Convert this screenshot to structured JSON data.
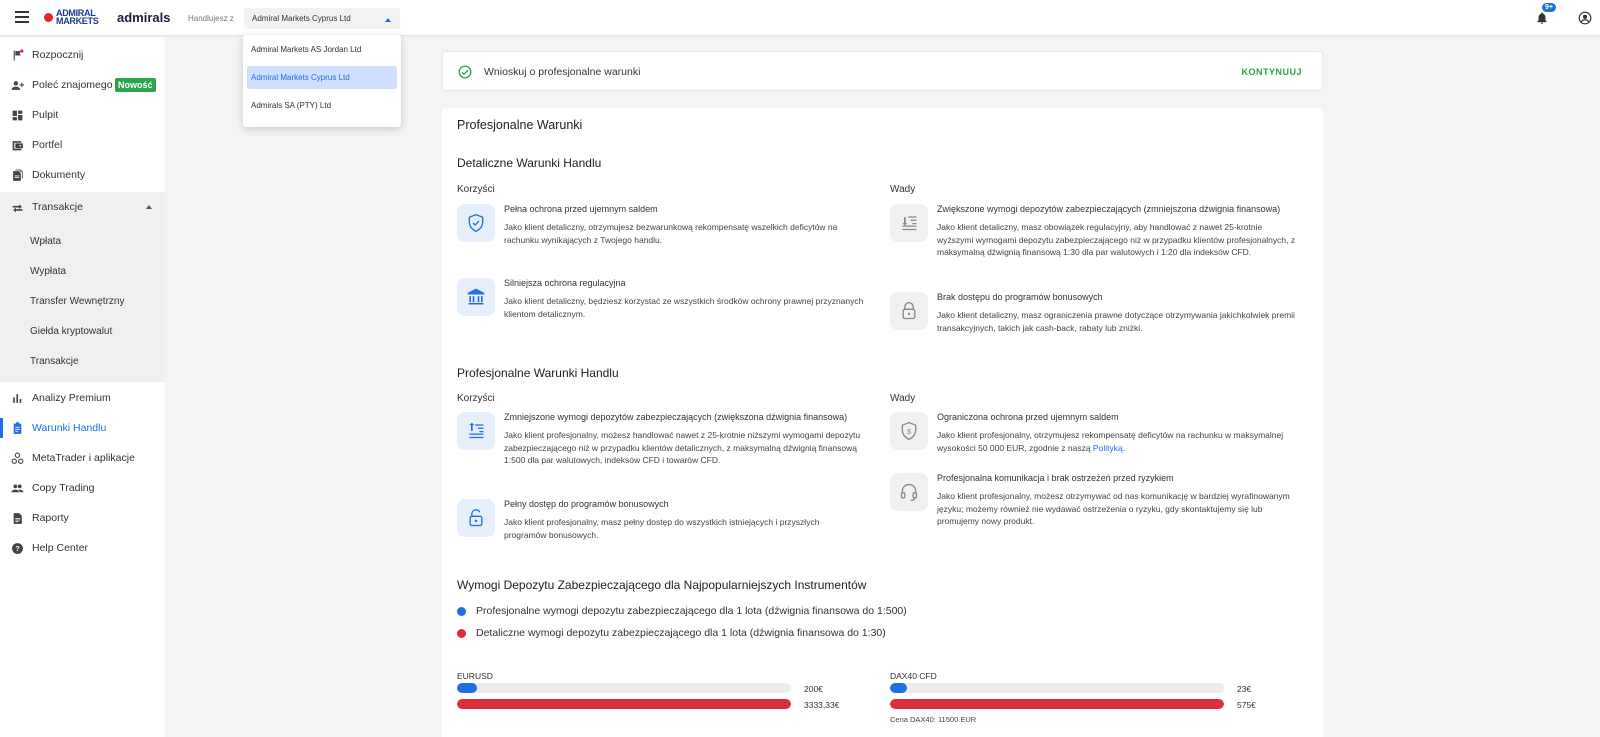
{
  "header": {
    "logo_line1": "ADMIRAL",
    "logo_line2": "MARKETS",
    "brand": "admirals",
    "trading_from_label": "Handlujesz z",
    "entity_selected": "Admiral Markets Cyprus Ltd",
    "notifications_badge": "9+"
  },
  "entity_dropdown": {
    "options": [
      "Admiral Markets AS Jordan Ltd",
      "Admiral Markets Cyprus Ltd",
      "Admirals SA (PTY) Ltd"
    ]
  },
  "sidebar": {
    "items": [
      {
        "label": "Rozpocznij",
        "icon": "flag-icon"
      },
      {
        "label": "Poleć znajomego",
        "icon": "add-person-icon",
        "badge": "Nowość"
      },
      {
        "label": "Pulpit",
        "icon": "dashboard-icon"
      },
      {
        "label": "Portfel",
        "icon": "wallet-icon"
      },
      {
        "label": "Dokumenty",
        "icon": "documents-icon"
      },
      {
        "label": "Transakcje",
        "icon": "transfer-icon"
      }
    ],
    "sub_items": [
      "Wpłata",
      "Wypłata",
      "Transfer Wewnętrzny",
      "Giełda kryptowalut",
      "Transakcje"
    ],
    "items_bottom": [
      {
        "label": "Analizy Premium",
        "icon": "bar-chart-icon"
      },
      {
        "label": "Warunki Handlu",
        "icon": "clipboard-icon"
      },
      {
        "label": "MetaTrader i aplikacje",
        "icon": "apps-icon"
      },
      {
        "label": "Copy Trading",
        "icon": "people-icon"
      },
      {
        "label": "Raporty",
        "icon": "report-icon"
      },
      {
        "label": "Help Center",
        "icon": "help-icon"
      }
    ]
  },
  "banner": {
    "text": "Wnioskuj o profesjonalne warunki",
    "action": "KONTYNUUJ"
  },
  "card": {
    "title": "Profesjonalne Warunki",
    "retail": {
      "title": "Detaliczne Warunki Handlu",
      "pros_label": "Korzyści",
      "cons_label": "Wady",
      "pros": [
        {
          "title": "Pełna ochrona przed ujemnym saldem",
          "desc": "Jako klient detaliczny, otrzymujesz bezwarunkową rekompensatę wszelkich deficytów na rachunku wynikających z Twojego handlu."
        },
        {
          "title": "Silniejsza ochrona regulacyjna",
          "desc": "Jako klient detaliczny, będziesz korzystać ze wszystkich środków ochrony prawnej przyznanych klientom detalicznym."
        }
      ],
      "cons": [
        {
          "title": "Zwiększone wymogi depozytów zabezpieczających (zmniejszona dźwignia finansowa)",
          "desc": "Jako klient detaliczny, masz obowiązek regulacyjny, aby handlować z nawet 25-krotnie wyższymi wymogami depozytu zabezpieczającego niż w przypadku klientów profesjonalnych, z maksymalną dźwignią finansową 1:30 dla par walutowych i 1:20 dla indeksów CFD."
        },
        {
          "title": "Brak dostępu do programów bonusowych",
          "desc": "Jako klient detaliczny, masz ograniczenia prawne dotyczące otrzymywania jakichkolwiek premii transakcyjnych, takich jak cash-back, rabaty lub zniżki."
        }
      ]
    },
    "pro": {
      "title": "Profesjonalne Warunki Handlu",
      "pros_label": "Korzyści",
      "cons_label": "Wady",
      "pros": [
        {
          "title": "Zmniejszone wymogi depozytów zabezpieczających (zwiększona dźwignia finansowa)",
          "desc": "Jako klient profesjonalny, możesz handlować nawet z 25-krotnie niższymi wymogami depozytu zabezpieczającego niż w przypadku klientów detalicznych, z maksymalną dźwignią finansową 1:500 dla par walutowych, indeksów CFD i towarów CFD."
        },
        {
          "title": "Pełny dostęp do programów bonusowych",
          "desc": "Jako klient profesjonalny, masz pełny dostęp do wszystkich istniejących i przyszłych programów bonusowych."
        }
      ],
      "cons": [
        {
          "title": "Ograniczona ochrona przed ujemnym saldem",
          "desc": "Jako klient profesjonalny, otrzymujesz rekompensatę deficytów na rachunku w maksymalnej wysokości 50 000 EUR, zgodnie z naszą ",
          "link": "Polityką",
          "desc_end": "."
        },
        {
          "title": "Profesjonalna komunikacja i brak ostrzeżeń przed ryzykiem",
          "desc": "Jako klient profesjonalny, możesz otrzymywać od nas komunikację w bardziej wyrafinowanym języku; możemy również nie wydawać ostrzeżenia o ryzyku, gdy skontaktujemy się lub promujemy nowy produkt."
        }
      ]
    },
    "margin": {
      "title": "Wymogi Depozytu Zabezpieczającego dla Najpopularniejszych Instrumentów",
      "legend_pro": "Profesjonalne wymogi depozytu zabezpieczającego dla 1 lota (dźwignia finansowa do 1:500)",
      "legend_retail": "Detaliczne wymogi depozytu zabezpieczającego dla 1 lota (dźwignia finansowa do 1:30)",
      "pro_color": "#1f6fe5",
      "retail_color": "#dc2f37",
      "instruments": [
        {
          "name": "EURUSD",
          "pro_value": 200,
          "pro_label": "200€",
          "retail_value": 3333.33,
          "retail_label": "3333,33€",
          "note": ""
        },
        {
          "name": "DAX40 CFD",
          "pro_value": 23,
          "pro_label": "23€",
          "retail_value": 575,
          "retail_label": "575€",
          "note": "Cena DAX40: 11500 EUR"
        }
      ]
    }
  }
}
